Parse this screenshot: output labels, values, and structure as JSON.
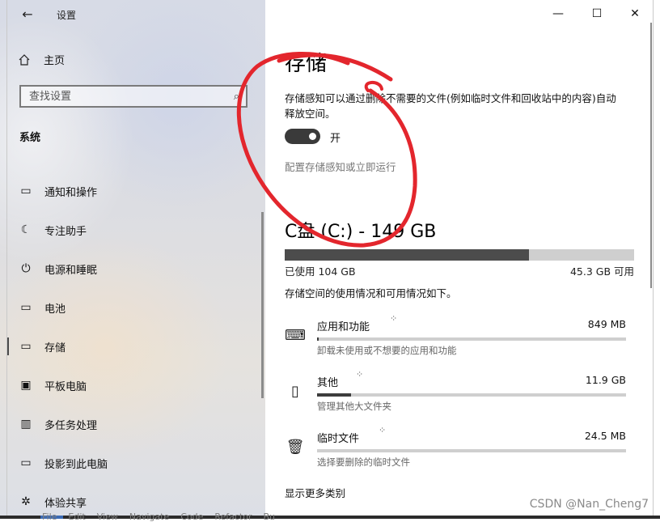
{
  "window": {
    "title": "设置",
    "back_glyph": "←",
    "minimize_glyph": "—",
    "maximize_glyph": "☐",
    "close_glyph": "✕"
  },
  "sidebar": {
    "home_label": "主页",
    "search_placeholder": "查找设置",
    "section_title": "系统",
    "items": [
      {
        "label": "通知和操作",
        "icon": "notification-icon",
        "glyph": "▭"
      },
      {
        "label": "专注助手",
        "icon": "moon-icon",
        "glyph": "☾"
      },
      {
        "label": "电源和睡眠",
        "icon": "power-icon",
        "glyph": "⏻"
      },
      {
        "label": "电池",
        "icon": "battery-icon",
        "glyph": "▭"
      },
      {
        "label": "存储",
        "icon": "storage-icon",
        "glyph": "▭",
        "selected": true
      },
      {
        "label": "平板电脑",
        "icon": "tablet-icon",
        "glyph": "▣"
      },
      {
        "label": "多任务处理",
        "icon": "multitask-icon",
        "glyph": "▥"
      },
      {
        "label": "投影到此电脑",
        "icon": "project-icon",
        "glyph": "▭"
      },
      {
        "label": "体验共享",
        "icon": "share-icon",
        "glyph": "✲"
      }
    ]
  },
  "main": {
    "title": "存储",
    "description": "存储感知可以通过删除不需要的文件(例如临时文件和回收站中的内容)自动释放空间。",
    "toggle_state": "on",
    "toggle_label": "开",
    "configure_link": "配置存储感知或立即运行",
    "drive_title": "C盘 (C:) - 149 GB",
    "used_label": "已使用 104 GB",
    "available_label": "45.3 GB 可用",
    "usage_fraction": 0.698,
    "summary": "存储空间的使用情况和可用情况如下。",
    "categories": [
      {
        "name": "应用和功能",
        "size": "849 MB",
        "sub": "卸载未使用或不想要的应用和功能",
        "fraction": 0.005,
        "icon": "keyboard-icon",
        "glyph": "⌨"
      },
      {
        "name": "其他",
        "size": "11.9 GB",
        "sub": "管理其他大文件夹",
        "fraction": 0.11,
        "icon": "folder-icon",
        "glyph": "▯"
      },
      {
        "name": "临时文件",
        "size": "24.5 MB",
        "sub": "选择要删除的临时文件",
        "fraction": 0.0,
        "icon": "trash-icon",
        "glyph": "🗑"
      }
    ],
    "show_more": "显示更多类别"
  },
  "watermark": "CSDN @Nan_Cheng7",
  "ide_menu": [
    "File",
    "Edit",
    "View",
    "Navigate",
    "Code",
    "Refactor",
    "Bu"
  ],
  "colors": {
    "annotation_red": "#e3262d",
    "toggle_on": "#3a3a3a",
    "bar_fill": "#4c4c4c",
    "bar_track": "#cfcfcf",
    "ide_strip": "#2b2b2b"
  }
}
